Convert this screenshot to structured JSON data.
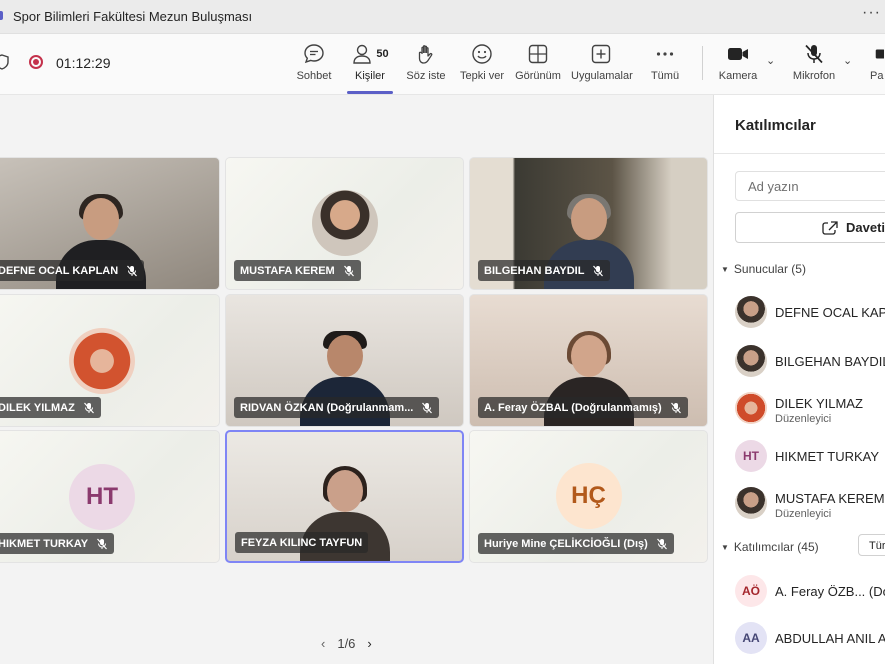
{
  "window": {
    "title": "Spor Bilimleri Fakültesi Mezun Buluşması",
    "more": "···"
  },
  "toolbar": {
    "timer": "01:12:29",
    "buttons": [
      {
        "label": "Sohbet",
        "icon": "chat-icon"
      },
      {
        "label": "Kişiler",
        "icon": "people-icon",
        "count": "50"
      },
      {
        "label": "Söz iste",
        "icon": "raise-hand-icon"
      },
      {
        "label": "Tepki ver",
        "icon": "react-icon"
      },
      {
        "label": "Görünüm",
        "icon": "view-icon"
      },
      {
        "label": "Uygulamalar",
        "icon": "apps-icon"
      },
      {
        "label": "Tümü",
        "icon": "more-icon"
      },
      {
        "label": "Kamera",
        "icon": "camera-icon"
      },
      {
        "label": "Mikrofon",
        "icon": "mic-off-icon"
      },
      {
        "label": "Pa",
        "icon": "share-icon"
      }
    ]
  },
  "tiles": [
    {
      "name": "DEFNE OCAL KAPLAN",
      "kind": "video"
    },
    {
      "name": "MUSTAFA KEREM",
      "kind": "photo"
    },
    {
      "name": "BILGEHAN BAYDIL",
      "kind": "video"
    },
    {
      "name": "DILEK YILMAZ",
      "kind": "photo"
    },
    {
      "name": "RIDVAN ÖZKAN (Doğrulanmam...",
      "kind": "video"
    },
    {
      "name": "A. Feray ÖZBAL (Doğrulanmamış)",
      "kind": "video"
    },
    {
      "name": "HIKMET TURKAY",
      "kind": "initials",
      "initials": "HT",
      "bg": "#ecd9e6",
      "fg": "#8b3a6e"
    },
    {
      "name": "FEYZA KILINC TAYFUN",
      "kind": "video"
    },
    {
      "name": "Huriye Mine ÇELİKCİOĞLI (Dış)",
      "kind": "initials",
      "initials": "HÇ",
      "bg": "#fde5cf",
      "fg": "#b2591b"
    }
  ],
  "pager": {
    "label": "1/6",
    "prev": "‹",
    "next": "›"
  },
  "panel": {
    "title": "Katılımcılar",
    "search_placeholder": "Ad yazın",
    "invite_label": "Daveti",
    "presenters_label": "Sunucular (5)",
    "presenters": [
      {
        "name": "DEFNE OCAL KAP",
        "role": "",
        "avatar": "photo"
      },
      {
        "name": "BILGEHAN BAYDIL",
        "role": "",
        "avatar": "photo"
      },
      {
        "name": "DILEK YILMAZ",
        "role": "Düzenleyici",
        "avatar": "red"
      },
      {
        "name": "HIKMET TURKAY",
        "role": "",
        "avatar": "init",
        "initials": "HT",
        "bg": "#ecd9e6",
        "fg": "#8b3a6e"
      },
      {
        "name": "MUSTAFA KEREM",
        "role": "Düzenleyici",
        "avatar": "photo"
      }
    ],
    "attendees_label": "Katılımcılar (45)",
    "turn_label": "Tür",
    "attendees": [
      {
        "name": "A. Feray ÖZB... (Do",
        "initials": "AÖ",
        "bg": "#fde7e9",
        "fg": "#a4262c"
      },
      {
        "name": "ABDULLAH ANIL A",
        "initials": "AA",
        "bg": "#e3e3f5",
        "fg": "#464775"
      }
    ]
  }
}
